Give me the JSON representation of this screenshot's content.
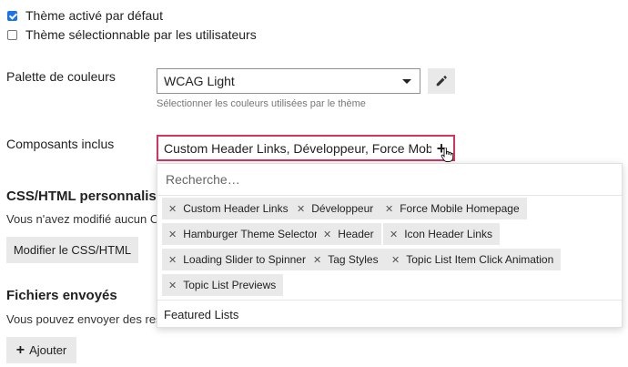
{
  "checkboxes": [
    {
      "label": "Thème activé par défaut",
      "checked": true
    },
    {
      "label": "Thème sélectionnable par les utilisateurs",
      "checked": false
    }
  ],
  "palette": {
    "label": "Palette de couleurs",
    "value": "WCAG Light",
    "help": "Sélectionner les couleurs utilisées par le thème",
    "edit_icon": "pencil-icon"
  },
  "components": {
    "label": "Composants inclus",
    "value": "Custom Header Links, Développeur, Force Mobile…",
    "add_icon": "plus-icon",
    "search_placeholder": "Recherche…",
    "selected": [
      "Custom Header Links",
      "Développeur",
      "Force Mobile Homepage",
      "Hamburger Theme Selector",
      "Header",
      "Icon Header Links",
      "Loading Slider to Spinner",
      "Tag Styles",
      "Topic List Item Click Animation",
      "Topic List Previews"
    ],
    "remove_glyph": "✕",
    "options": [
      "Featured Lists"
    ]
  },
  "css_section": {
    "heading": "CSS/HTML personnalisé",
    "text": "Vous n'avez modifié aucun C",
    "button": "Modifier le CSS/HTML"
  },
  "files_section": {
    "heading": "Fichiers envoyés",
    "text": "Vous pouvez envoyer des res",
    "button": "Ajouter",
    "button_icon": "plus-icon"
  },
  "colors": {
    "accent_border": "#d6345d",
    "checkbox_blue": "#1a73e8",
    "chip_bg": "#e9e9e9"
  }
}
